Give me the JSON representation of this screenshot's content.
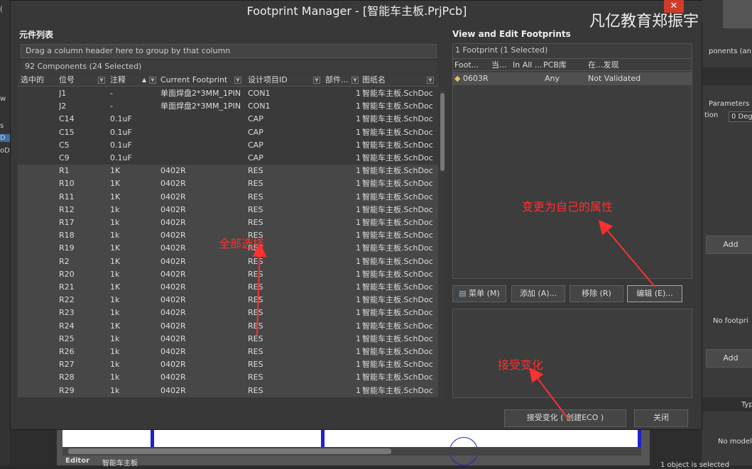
{
  "bg": {
    "left_labels": [
      "(",
      "w",
      "s",
      "D",
      "oD"
    ],
    "right_texts": {
      "components": "ponents (an",
      "parameters": "Parameters",
      "tion": "tion",
      "deg": "0 Deg",
      "no_footprint": "No footpri",
      "no_model": "No model",
      "typ": "Typ",
      "selected": "1 object is selected"
    },
    "add_label": "Add",
    "tabs": [
      "Editor",
      "智能车主板"
    ]
  },
  "dialog": {
    "title": "Footprint Manager - [智能车主板.PrjPcb]",
    "close_glyph": "✕",
    "watermark": "凡亿教育郑振宇"
  },
  "left": {
    "title": "元件列表",
    "group_hint": "Drag a column header here to group by that column",
    "count": "92 Components (24 Selected)",
    "columns": [
      "选中的",
      "位号",
      "注释",
      "Current Footprint",
      "设计项目ID",
      "部件...",
      "图纸名"
    ],
    "rows": [
      {
        "sel": false,
        "ref": "J1",
        "comment": "-",
        "fp": "单面焊盘2*3MM_1PIN",
        "id": "CON1",
        "part": "1",
        "sheet": "智能车主板.SchDoc"
      },
      {
        "sel": false,
        "ref": "J2",
        "comment": "-",
        "fp": "单面焊盘2*3MM_1PIN",
        "id": "CON1",
        "part": "1",
        "sheet": "智能车主板.SchDoc"
      },
      {
        "sel": false,
        "ref": "C14",
        "comment": "0.1uF",
        "fp": "",
        "id": "CAP",
        "part": "1",
        "sheet": "智能车主板.SchDoc"
      },
      {
        "sel": false,
        "ref": "C15",
        "comment": "0.1uF",
        "fp": "",
        "id": "CAP",
        "part": "1",
        "sheet": "智能车主板.SchDoc"
      },
      {
        "sel": false,
        "ref": "C5",
        "comment": "0.1uF",
        "fp": "",
        "id": "CAP",
        "part": "1",
        "sheet": "智能车主板.SchDoc"
      },
      {
        "sel": false,
        "ref": "C9",
        "comment": "0.1uF",
        "fp": "",
        "id": "CAP",
        "part": "1",
        "sheet": "智能车主板.SchDoc"
      },
      {
        "sel": true,
        "ref": "R1",
        "comment": "1K",
        "fp": "0402R",
        "id": "RES",
        "part": "1",
        "sheet": "智能车主板.SchDoc"
      },
      {
        "sel": true,
        "ref": "R10",
        "comment": "1K",
        "fp": "0402R",
        "id": "RES",
        "part": "1",
        "sheet": "智能车主板.SchDoc"
      },
      {
        "sel": true,
        "ref": "R11",
        "comment": "1K",
        "fp": "0402R",
        "id": "RES",
        "part": "1",
        "sheet": "智能车主板.SchDoc"
      },
      {
        "sel": true,
        "ref": "R12",
        "comment": "1k",
        "fp": "0402R",
        "id": "RES",
        "part": "1",
        "sheet": "智能车主板.SchDoc"
      },
      {
        "sel": true,
        "ref": "R17",
        "comment": "1k",
        "fp": "0402R",
        "id": "RES",
        "part": "1",
        "sheet": "智能车主板.SchDoc"
      },
      {
        "sel": true,
        "ref": "R18",
        "comment": "1k",
        "fp": "0402R",
        "id": "RES",
        "part": "1",
        "sheet": "智能车主板.SchDoc"
      },
      {
        "sel": true,
        "ref": "R19",
        "comment": "1K",
        "fp": "0402R",
        "id": "RES",
        "part": "1",
        "sheet": "智能车主板.SchDoc"
      },
      {
        "sel": true,
        "ref": "R2",
        "comment": "1K",
        "fp": "0402R",
        "id": "RES",
        "part": "1",
        "sheet": "智能车主板.SchDoc"
      },
      {
        "sel": true,
        "ref": "R20",
        "comment": "1k",
        "fp": "0402R",
        "id": "RES",
        "part": "1",
        "sheet": "智能车主板.SchDoc"
      },
      {
        "sel": true,
        "ref": "R21",
        "comment": "1K",
        "fp": "0402R",
        "id": "RES",
        "part": "1",
        "sheet": "智能车主板.SchDoc"
      },
      {
        "sel": true,
        "ref": "R22",
        "comment": "1k",
        "fp": "0402R",
        "id": "RES",
        "part": "1",
        "sheet": "智能车主板.SchDoc"
      },
      {
        "sel": true,
        "ref": "R23",
        "comment": "1k",
        "fp": "0402R",
        "id": "RES",
        "part": "1",
        "sheet": "智能车主板.SchDoc"
      },
      {
        "sel": true,
        "ref": "R24",
        "comment": "1K",
        "fp": "0402R",
        "id": "RES",
        "part": "1",
        "sheet": "智能车主板.SchDoc"
      },
      {
        "sel": true,
        "ref": "R25",
        "comment": "1k",
        "fp": "0402R",
        "id": "RES",
        "part": "1",
        "sheet": "智能车主板.SchDoc"
      },
      {
        "sel": true,
        "ref": "R26",
        "comment": "1k",
        "fp": "0402R",
        "id": "RES",
        "part": "1",
        "sheet": "智能车主板.SchDoc"
      },
      {
        "sel": true,
        "ref": "R27",
        "comment": "1k",
        "fp": "0402R",
        "id": "RES",
        "part": "1",
        "sheet": "智能车主板.SchDoc"
      },
      {
        "sel": true,
        "ref": "R28",
        "comment": "1k",
        "fp": "0402R",
        "id": "RES",
        "part": "1",
        "sheet": "智能车主板.SchDoc"
      },
      {
        "sel": true,
        "ref": "R29",
        "comment": "1k",
        "fp": "0402R",
        "id": "RES",
        "part": "1",
        "sheet": "智能车主板.SchDoc"
      }
    ]
  },
  "right": {
    "title": "View and Edit Footprints",
    "fp_count": "1 Footprint (1 Selected)",
    "columns": [
      "Foot...",
      "当...",
      "In All ...",
      "PCB库",
      "在...发现"
    ],
    "fp_row": {
      "name": "0603R",
      "lib": "Any",
      "found": "Not Validated"
    },
    "buttons": {
      "menu": "菜单 (M)",
      "add": "添加 (A)...",
      "remove": "移除 (R)",
      "edit": "编辑 (E)..."
    }
  },
  "footer": {
    "accept": "接受变化 ( 创建ECO )",
    "close": "关闭"
  },
  "annotations": {
    "select_all": "全部选择",
    "change_props": "变更为自己的属性",
    "accept_change": "接受变化"
  },
  "colors": {
    "annotation": "#ff3030",
    "close_button": "#d13b2a"
  }
}
